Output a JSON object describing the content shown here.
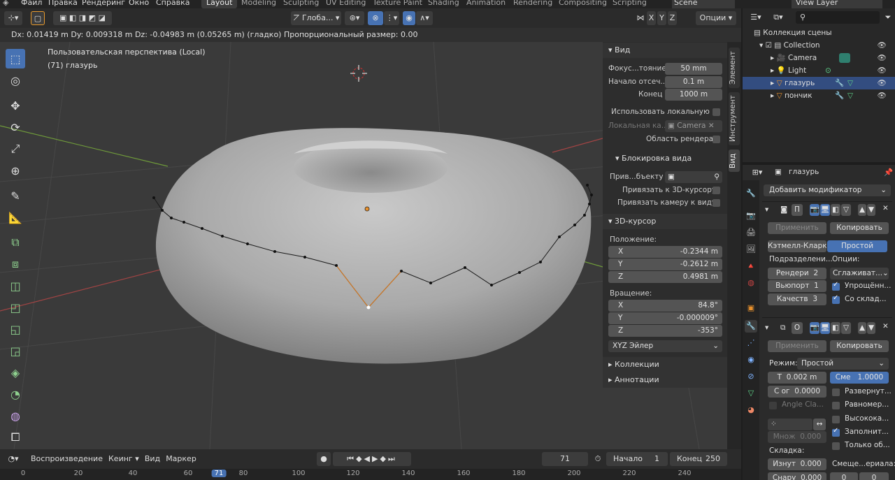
{
  "menu": {
    "items": [
      "Файл",
      "Правка",
      "Рендеринг",
      "Окно",
      "Справка"
    ]
  },
  "workspaces": {
    "tabs": [
      "Layout",
      "Modeling",
      "Sculpting",
      "UV Editing",
      "Texture Paint",
      "Shading",
      "Animation",
      "Rendering",
      "Compositing",
      "Scripting"
    ],
    "active": "Layout"
  },
  "scene": {
    "name": "Scene",
    "view_layer": "View Layer"
  },
  "viewport_header": {
    "orientation": "Глоба...",
    "axes": [
      "X",
      "Y",
      "Z"
    ],
    "options": "Опции"
  },
  "status_line": "Dx: 0.01419 m   Dy: 0.009318 m   Dz: -0.04983 m (0.05265 m) (гладко)   Пропорциональный размер: 0.00",
  "viewport": {
    "perspective": "Пользовательская перспектива (Local)",
    "object_info": "(71) глазурь"
  },
  "npanel": {
    "tabs": [
      "Элемент",
      "Инструмент",
      "Вид"
    ],
    "view": {
      "title": "Вид",
      "focal_label": "Фокус...тояние",
      "focal_value": "50 mm",
      "clip_start_label": "Начало отсеч...",
      "clip_start_value": "0.1 m",
      "clip_end_label": "Конец",
      "clip_end_value": "1000 m",
      "local_camera_label": "Использовать локальную ...",
      "local_camera_field_label": "Локальная ка...",
      "local_camera_value": "Camera",
      "render_region_label": "Область рендера"
    },
    "view_lock": {
      "title": "Блокировка вида",
      "lock_object_label": "Прив...бъекту",
      "lock_cursor_label": "Привязать к 3D-курсору",
      "lock_camera_label": "Привязать камеру к виду"
    },
    "cursor": {
      "title": "3D-курсор",
      "location_label": "Положение:",
      "loc": [
        {
          "axis": "X",
          "value": "-0.2344 m"
        },
        {
          "axis": "Y",
          "value": "-0.2612 m"
        },
        {
          "axis": "Z",
          "value": "0.4981 m"
        }
      ],
      "rotation_label": "Вращение:",
      "rot": [
        {
          "axis": "X",
          "value": "84.8°"
        },
        {
          "axis": "Y",
          "value": "-0.000009°"
        },
        {
          "axis": "Z",
          "value": "-353°"
        }
      ],
      "mode": "XYZ Эйлер"
    },
    "collections_title": "Коллекции",
    "annotations_title": "Аннотации"
  },
  "timeline": {
    "playback": "Воспроизведение",
    "keying": "Кеинг",
    "view": "Вид",
    "marker": "Маркер",
    "current_frame": "71",
    "start_label": "Начало",
    "start": "1",
    "end_label": "Конец",
    "end": "250",
    "ruler": [
      "0",
      "20",
      "40",
      "60",
      "71",
      "80",
      "100",
      "120",
      "140",
      "160",
      "180",
      "200",
      "220",
      "240"
    ]
  },
  "outliner": {
    "scene_collection": "Коллекция сцены",
    "items": [
      {
        "name": "Collection"
      },
      {
        "name": "Camera"
      },
      {
        "name": "Light"
      },
      {
        "name": "глазурь"
      },
      {
        "name": "пончик"
      }
    ]
  },
  "properties": {
    "object_name": "глазурь",
    "add_modifier": "Добавить модификатор",
    "mod1": {
      "name": "П",
      "apply": "Применить",
      "copy": "Копировать",
      "catmull": "Кэтмелл-Кларк",
      "simple": "Простой",
      "subdiv_label": "Подразделени...",
      "options_label": "Опции:",
      "render_label": "Рендери",
      "render_value": "2",
      "viewport_label": "Вьюпорт",
      "viewport_value": "1",
      "quality_label": "Качеств",
      "quality_value": "3",
      "uv_smooth": "Сглаживат...",
      "simplify": "Упрощённ...",
      "fold": "Со склад..."
    },
    "mod2": {
      "name": "О",
      "apply": "Применить",
      "copy": "Копировать",
      "mode_label": "Режим:",
      "mode_value": "Простой",
      "thickness_label": "Т",
      "thickness_value": "0.002 m",
      "offset_label": "Сме",
      "offset_value": "1.0000",
      "clamp_label": "С ог",
      "clamp_value": "0.0000",
      "flip": "Развернут...",
      "angle_clamp": "Angle Cla...",
      "even": "Равномер...",
      "high_quality": "Высокока...",
      "factor_label": "Множ",
      "factor_value": "0.000",
      "fill": "Заполнит...",
      "only_rim": "Только об...",
      "crease_label": "Складка:",
      "inner_label": "Изнут",
      "inner_value": "0.000",
      "offset_mat_label": "Смеще...ериала:",
      "outer_label": "Снару",
      "outer_value": "0.000",
      "mat_a": "0",
      "mat_b": "0"
    }
  }
}
